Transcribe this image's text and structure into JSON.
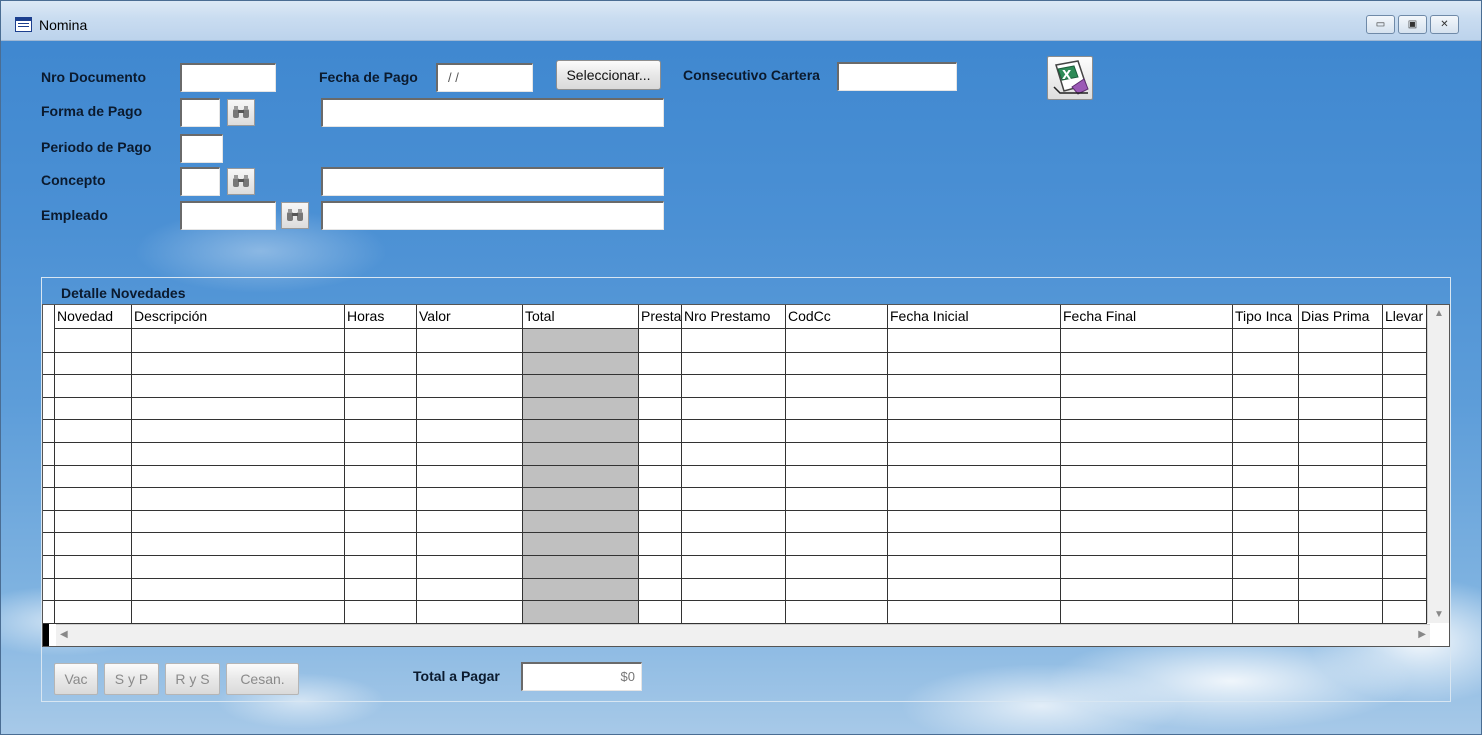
{
  "window": {
    "title": "Nomina",
    "controls": {
      "minimize": "▭",
      "maximize": "▣",
      "close": "✕"
    }
  },
  "form": {
    "nro_documento_label": "Nro Documento",
    "nro_documento_value": "",
    "fecha_pago_label": "Fecha de Pago",
    "fecha_pago_value": " / /",
    "seleccionar_label": "Seleccionar...",
    "consecutivo_label": "Consecutivo Cartera",
    "consecutivo_value": "",
    "forma_pago_label": "Forma de Pago",
    "periodo_pago_label": "Periodo de Pago",
    "concepto_label": "Concepto",
    "empleado_label": "Empleado"
  },
  "icons": {
    "find": "binoculars-icon",
    "excel": "excel-export-icon",
    "find_glyph": "🔍"
  },
  "panel": {
    "title": "Detalle Novedades",
    "columns": [
      "Novedad",
      "Descripción",
      "Horas",
      "Valor",
      "Total",
      "Presta",
      "Nro Prestamo",
      "CodCc",
      "Fecha Inicial",
      "Fecha Final",
      "Tipo Inca",
      "Dias Prima",
      "Llevar"
    ],
    "row_count": 13
  },
  "footer": {
    "buttons": [
      "Vac",
      "S y P",
      "R y S",
      "Cesan."
    ],
    "total_label": "Total a Pagar",
    "total_value": "$0"
  }
}
